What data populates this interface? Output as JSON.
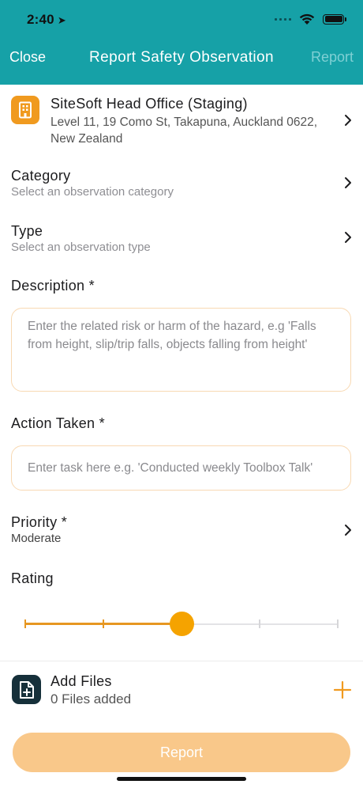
{
  "status_bar": {
    "time": "2:40"
  },
  "nav": {
    "close_label": "Close",
    "title": "Report Safety Observation",
    "report_label": "Report"
  },
  "location": {
    "icon": "building-icon",
    "name": "SiteSoft Head Office (Staging)",
    "address": "Level 11, 19 Como St, Takapuna, Auckland 0622, New Zealand"
  },
  "category": {
    "label": "Category",
    "placeholder": "Select an observation category"
  },
  "type": {
    "label": "Type",
    "placeholder": "Select an observation type"
  },
  "description": {
    "label": "Description *",
    "placeholder": "Enter the related risk or harm of the hazard, e.g 'Falls from height, slip/trip falls, objects falling from height'"
  },
  "action_taken": {
    "label": "Action Taken *",
    "placeholder": "Enter task here e.g. 'Conducted weekly Toolbox Talk'"
  },
  "priority": {
    "label": "Priority *",
    "value": "Moderate"
  },
  "rating": {
    "label": "Rating",
    "steps": 5,
    "selected_index": 2,
    "fraction": 0.5
  },
  "files": {
    "label": "Add Files",
    "count_text": "0 Files added"
  },
  "footer": {
    "report_label": "Report"
  },
  "colors": {
    "header": "#16a1a7",
    "accent_orange": "#f09a1f",
    "slider_fill": "#e69722",
    "slider_thumb": "#f5a300",
    "report_button": "#f9c88a",
    "file_icon_bg": "#16303a"
  }
}
